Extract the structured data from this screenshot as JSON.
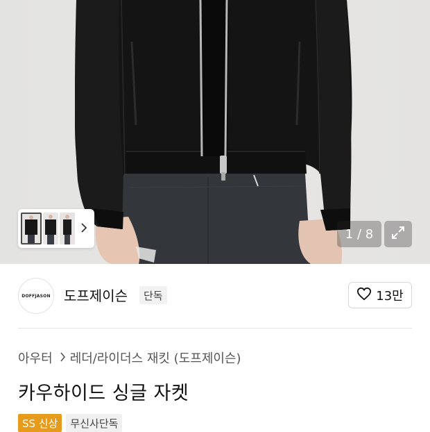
{
  "gallery": {
    "counter": "1 / 8",
    "thumbnail_count": 3,
    "icons": {
      "next": "chevron-right-icon",
      "expand": "expand-icon"
    }
  },
  "brand": {
    "logo_text": "DOFFJASON",
    "name": "도프제이슨",
    "badge": "단독",
    "like_count": "13만"
  },
  "breadcrumb": {
    "category": "아우터",
    "subcategory": "레더/라이더스 재킷 (도프제이슨)"
  },
  "product": {
    "title": "카우하이드 싱글 자켓"
  },
  "tags": {
    "season": "SS 신상",
    "exclusive": "무신사단독"
  },
  "colors": {
    "season_tag": "#e79b1c",
    "jacket": "#141414",
    "jeans": "#33363b"
  }
}
